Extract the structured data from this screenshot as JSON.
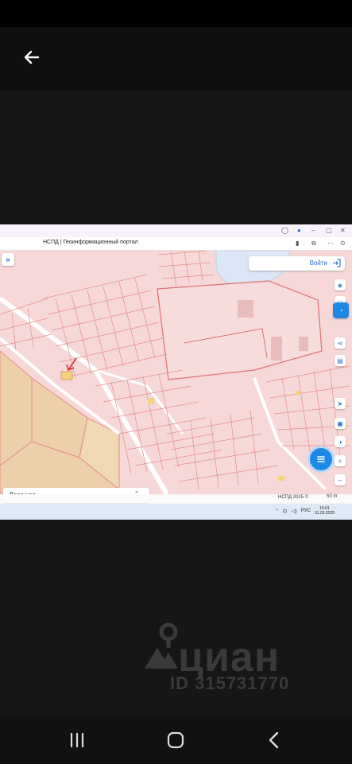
{
  "browser": {
    "tab_title": "НСПД | Геоинформационный портал"
  },
  "map": {
    "login_label": "Войти",
    "legend_label": "Легенда",
    "copyright": "НСПД 2025 ©",
    "scale_label": "50 m"
  },
  "taskbar": {
    "lang": "РУС",
    "time": "15:01",
    "date": "31.03.2025"
  },
  "watermark": {
    "brand": "циан",
    "listing_id": "ID 315731770"
  },
  "colors": {
    "parcel_fill": "#f6d8d8",
    "parcel_stroke": "#e58a8a",
    "water": "#dbe6f6",
    "accent": "#1e88e5"
  }
}
